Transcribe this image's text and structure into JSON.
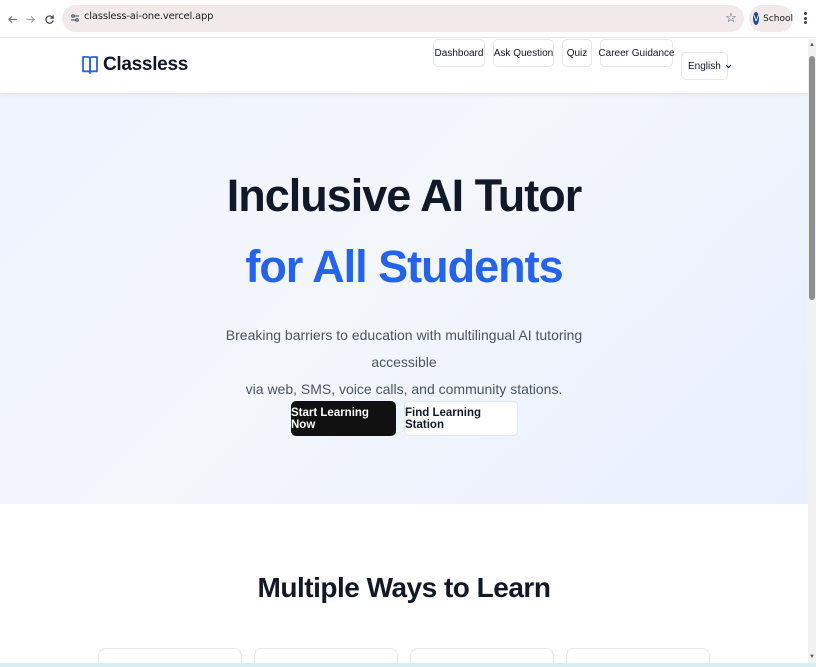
{
  "browser": {
    "url": "classless-ai-one.vercel.app",
    "profile_initial": "V",
    "profile_label": "School",
    "icons": [
      "back-arrow-icon",
      "forward-arrow-icon",
      "reload-icon",
      "site-info-icon",
      "bookmark-star-icon",
      "kebab-menu-icon"
    ]
  },
  "header": {
    "brand": "Classless",
    "brand_icon": "open-book-icon",
    "nav": [
      "Dashboard",
      "Ask Question",
      "Quiz",
      "Career Guidance"
    ],
    "language": "English"
  },
  "hero": {
    "title_line1": "Inclusive AI Tutor",
    "title_line2": "for All Students",
    "subtitle_line1": "Breaking barriers to education with multilingual AI tutoring accessible",
    "subtitle_line2": "via web, SMS, voice calls, and community stations.",
    "primary_cta": "Start Learning Now",
    "secondary_cta": "Find Learning Station"
  },
  "features": {
    "title": "Multiple Ways to Learn"
  },
  "colors": {
    "accent": "#2563eb",
    "primary_button": "#111111",
    "hero_bg": "#eff4ff",
    "text_dark": "#111827"
  }
}
